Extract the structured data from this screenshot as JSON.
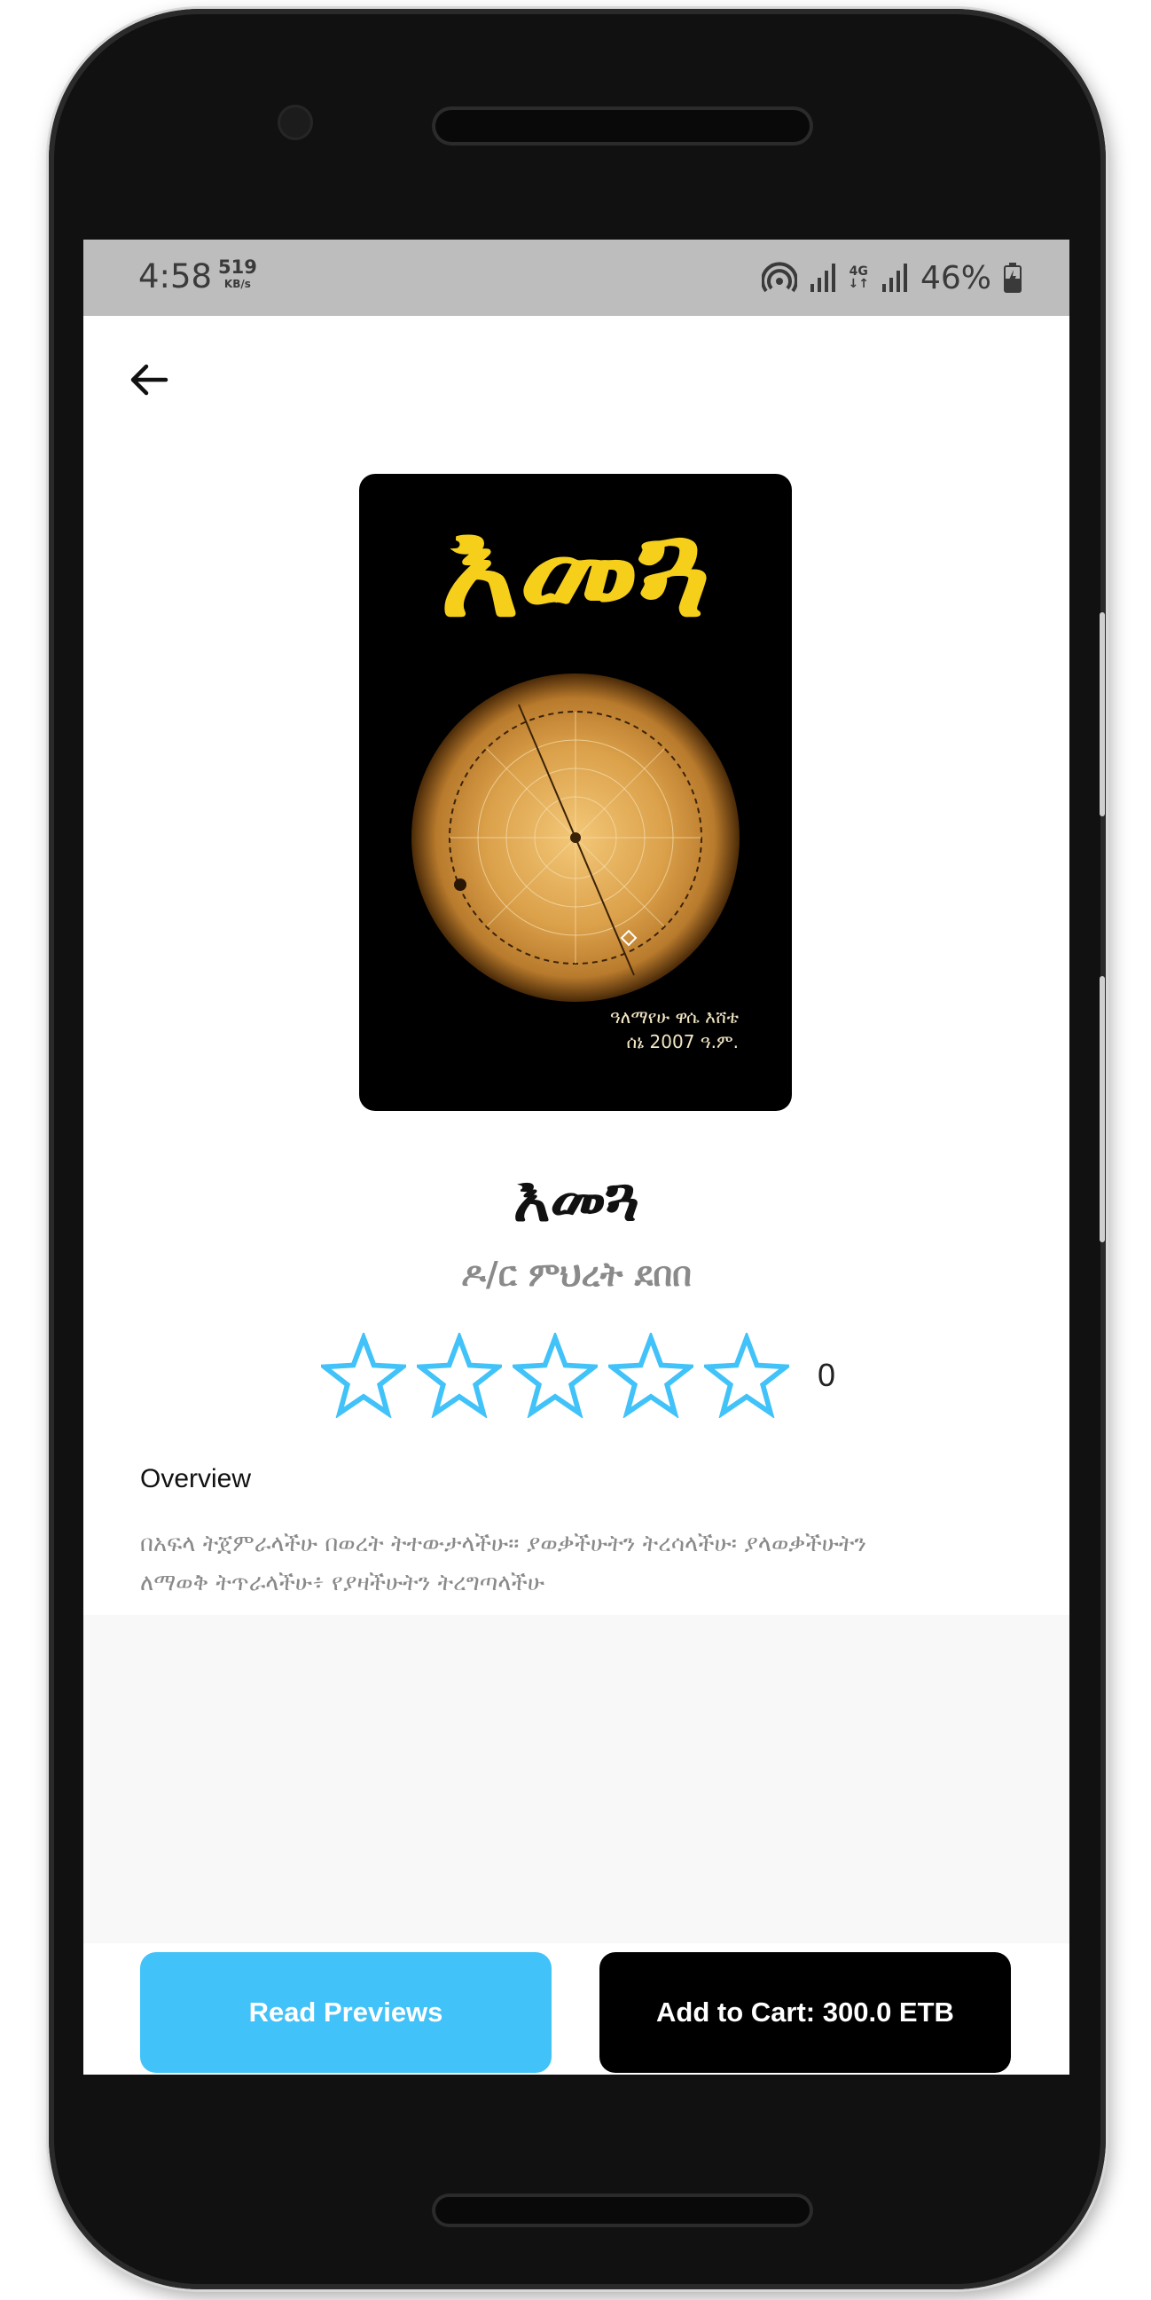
{
  "status_bar": {
    "time": "4:58",
    "speed_value": "519",
    "speed_unit": "KB/s",
    "network": "4G",
    "battery": "46%",
    "icons": [
      "hotspot-icon",
      "signal-icon",
      "4g-data-icon",
      "signal-icon",
      "battery-charging-icon"
    ]
  },
  "nav": {
    "back_icon": "arrow-left-icon"
  },
  "book": {
    "cover_title": "እመጓ",
    "cover_author_line1": "ዓለማየሁ ዋሴ እሸቴ",
    "cover_author_line2": "ሰኔ 2007 ዓ.ም.",
    "title": "እመጓ",
    "author": "ዶ/ር ምህረት ደበበ",
    "rating_value": 0,
    "rating_max": 5,
    "rating_count": "0"
  },
  "overview": {
    "label": "Overview",
    "text_line1": "በአፍላ ትጀምራላችሁ በወረት ትተውታላችሁ። ያወቃችሁትን ትረሳላችሁ፡ ያላወቃችሁትን",
    "text_line2": "ለማወቅ ትጥራላችሁ፥ የያዛችሁትን ትረግጣላችሁ"
  },
  "actions": {
    "read_label": "Read Previews",
    "cart_label": "Add to Cart: 300.0 ETB"
  },
  "colors": {
    "accent": "#41c2f8",
    "star_outline": "#41c2f8",
    "cart_button": "#000000",
    "status_bar": "#bdbdbd"
  }
}
